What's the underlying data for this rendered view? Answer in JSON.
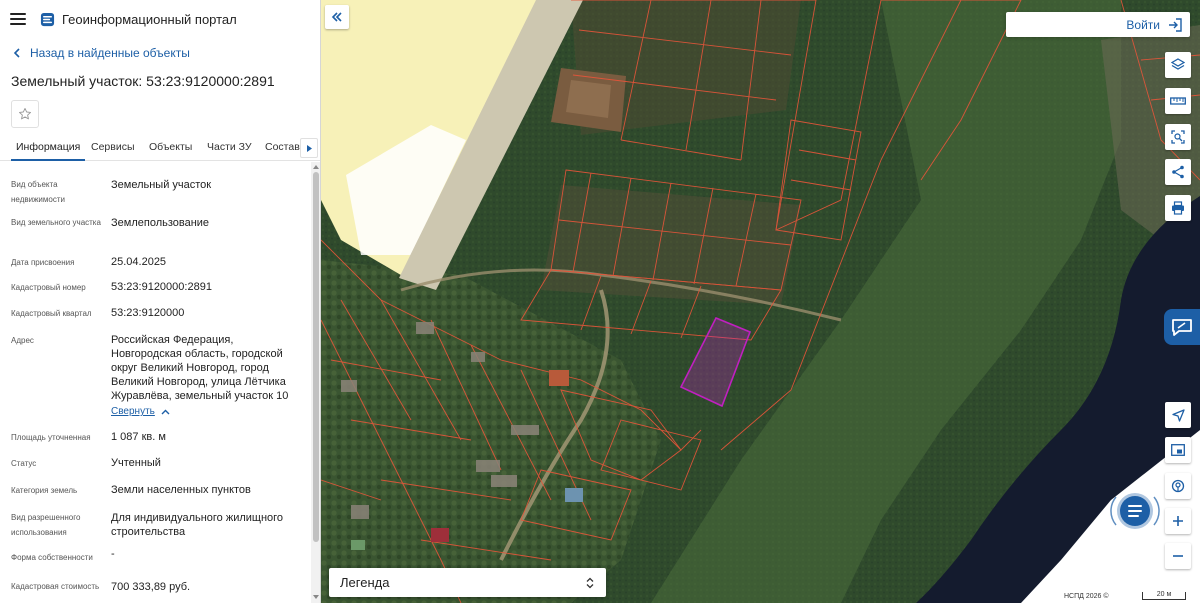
{
  "app": {
    "title": "Геоинформационный портал"
  },
  "sidebar": {
    "back_label": "Назад в найденные объекты",
    "object_title": "Земельный участок: 53:23:9120000:2891",
    "tabs": [
      "Информация",
      "Сервисы",
      "Объекты",
      "Части ЗУ",
      "Состав"
    ],
    "active_tab": "Информация",
    "properties": [
      {
        "label": "Вид объекта недвижимости",
        "value": "Земельный участок"
      },
      {
        "label": "Вид земельного участка",
        "value": "Землепользование"
      },
      {
        "label": "Дата присвоения",
        "value": "25.04.2025"
      },
      {
        "label": "Кадастровый номер",
        "value": "53:23:9120000:2891"
      },
      {
        "label": "Кадастровый квартал",
        "value": "53:23:9120000"
      },
      {
        "label": "Адрес",
        "value": "Российская Федерация, Новгородская область, городской округ Великий Новгород, город Великий Новгород, улица Лётчика Журавлёва, земельный участок 10"
      },
      {
        "label": "Площадь уточненная",
        "value": "1 087 кв. м"
      },
      {
        "label": "Статус",
        "value": "Учтенный"
      },
      {
        "label": "Категория земель",
        "value": "Земли населенных пунктов"
      },
      {
        "label": "Вид разрешенного использования",
        "value": "Для индивидуального жилищного строительства"
      },
      {
        "label": "Форма собственности",
        "value": "-"
      },
      {
        "label": "Кадастровая стоимость",
        "value": "700 333,89 руб."
      }
    ],
    "collapse_label": "Свернуть"
  },
  "map": {
    "login_label": "Войти",
    "legend_label": "Легенда",
    "copyright": "НСПД 2026 ©",
    "scale_label": "20 м",
    "colors": {
      "accent": "#1d5fa6",
      "parcel_boundary": "#e8553a",
      "selected_parcel": "#c020c0",
      "river": "#141b2e",
      "field": "#2f4a2c"
    }
  }
}
